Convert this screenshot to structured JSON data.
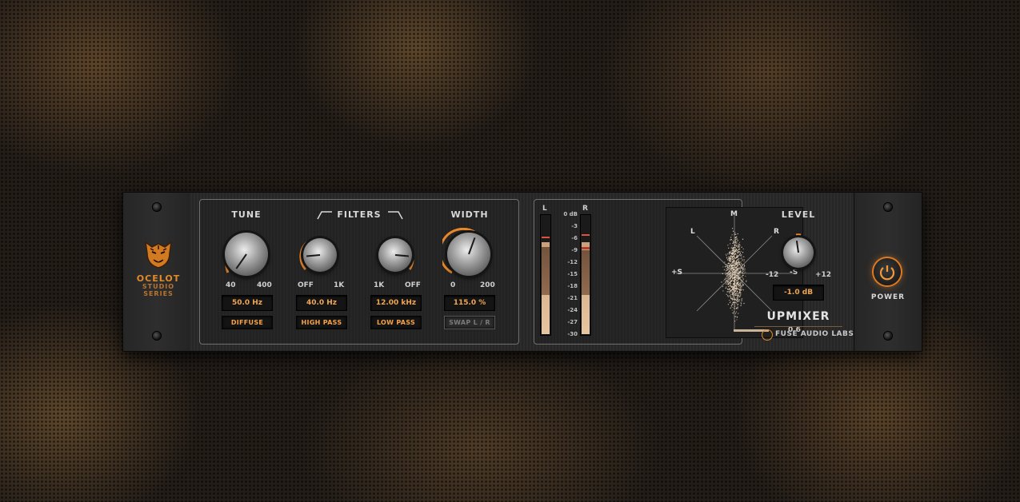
{
  "brand": {
    "series_line1": "OCELOT",
    "series_line2": "STUDIO",
    "series_line3": "SERIES",
    "product": "UPMIXER",
    "company": "FUSE AUDIO LABS"
  },
  "tune": {
    "label": "TUNE",
    "min": "40",
    "max": "400",
    "value": "50.0 Hz",
    "level": 0.03,
    "button": "DIFFUSE"
  },
  "filters": {
    "label": "FILTERS",
    "highpass": {
      "min": "OFF",
      "max": "1K",
      "value": "40.0 Hz",
      "button": "HIGH PASS",
      "level": 0.25
    },
    "lowpass": {
      "min": "1K",
      "max": "OFF",
      "value": "12.00 kHz",
      "button": "LOW PASS",
      "level": 0.8
    }
  },
  "width": {
    "label": "WIDTH",
    "min": "0",
    "max": "200",
    "value": "115.0 %",
    "level": 0.575,
    "button": "SWAP L / R"
  },
  "meters": {
    "left_label": "L",
    "right_label": "R",
    "db_marks": [
      "0 dB",
      "-3",
      "-6",
      "-9",
      "-12",
      "-15",
      "-18",
      "-21",
      "-24",
      "-27",
      "-30"
    ],
    "left_level": 0.78,
    "right_level": 0.78
  },
  "scope": {
    "top": "M",
    "left_diag": "L",
    "right_diag": "R",
    "left_side": "+S",
    "right_side": "-S",
    "correlation": "0.6"
  },
  "level": {
    "label": "LEVEL",
    "min": "-12",
    "max": "+12",
    "value": "-1.0 dB",
    "level": 0.46
  },
  "power": {
    "label": "POWER"
  },
  "colors": {
    "accent": "#e8862a",
    "value_text": "#f0a552"
  }
}
